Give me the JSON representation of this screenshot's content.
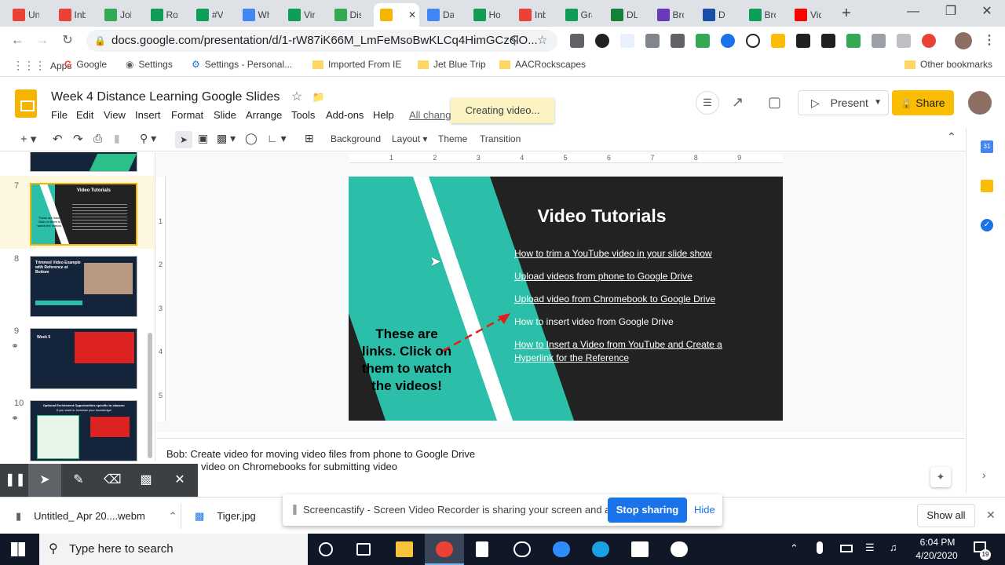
{
  "browser": {
    "tabs": [
      {
        "label": "Unt",
        "icon": "gmail-icon",
        "color": "#ea4335"
      },
      {
        "label": "Inb",
        "icon": "gmail-icon",
        "color": "#ea4335"
      },
      {
        "label": "Job",
        "icon": "drive-icon",
        "color": "#34a853"
      },
      {
        "label": "Rog",
        "icon": "sheets-icon",
        "color": "#0f9d58"
      },
      {
        "label": "#V",
        "icon": "sheets-icon",
        "color": "#0f9d58"
      },
      {
        "label": "Wh",
        "icon": "calendar-icon",
        "color": "#4285f4"
      },
      {
        "label": "Virt",
        "icon": "sheets-icon",
        "color": "#0f9d58"
      },
      {
        "label": "Dis",
        "icon": "drive-icon",
        "color": "#34a853"
      },
      {
        "label": "",
        "icon": "slides-icon",
        "color": "#f4b400",
        "active": true
      },
      {
        "label": "Dad",
        "icon": "docs-icon",
        "color": "#4285f4"
      },
      {
        "label": "Ho",
        "icon": "sheets-icon",
        "color": "#0f9d58"
      },
      {
        "label": "Inb",
        "icon": "gmail-icon",
        "color": "#ea4335"
      },
      {
        "label": "Gra",
        "icon": "sheets-icon",
        "color": "#0f9d58"
      },
      {
        "label": "DL",
        "icon": "classroom-icon",
        "color": "#188038"
      },
      {
        "label": "Bro",
        "icon": "forms-icon",
        "color": "#673ab7"
      },
      {
        "label": "D",
        "icon": "extension-icon",
        "color": "#174ea6"
      },
      {
        "label": "Bro",
        "icon": "sheets-icon",
        "color": "#0f9d58"
      },
      {
        "label": "Vid",
        "icon": "youtube-icon",
        "color": "#ff0000"
      }
    ],
    "url": "docs.google.com/presentation/d/1-rW87iK66M_LmFeMsoBwKLCq4HimGCz6lO...",
    "bookmarks": [
      {
        "label": "Apps",
        "icon": "apps-icon"
      },
      {
        "label": "Google",
        "icon": "google-icon"
      },
      {
        "label": "Settings",
        "icon": "globe-icon"
      },
      {
        "label": "Settings - Personal...",
        "icon": "gear-icon"
      },
      {
        "label": "Imported From IE",
        "icon": "folder-icon"
      },
      {
        "label": "Jet Blue Trip",
        "icon": "folder-icon"
      },
      {
        "label": "AACRockscapes",
        "icon": "folder-icon"
      }
    ],
    "other_bookmarks": "Other bookmarks"
  },
  "slides": {
    "doc_title": "Week 4 Distance Learning Google Slides",
    "menu": [
      "File",
      "Edit",
      "View",
      "Insert",
      "Format",
      "Slide",
      "Arrange",
      "Tools",
      "Add-ons",
      "Help",
      "All chang"
    ],
    "toast": "Creating video...",
    "present_label": "Present",
    "share_label": "Share",
    "toolbar": {
      "background": "Background",
      "layout": "Layout",
      "theme": "Theme",
      "transition": "Transition"
    },
    "ruler": [
      "1",
      "2",
      "3",
      "4",
      "5",
      "6",
      "7",
      "8",
      "9"
    ],
    "vruler": [
      "1",
      "2",
      "3",
      "4",
      "5"
    ],
    "filmstrip": [
      {
        "num": "7",
        "title": "Video Tutorials",
        "caption": "These are links. Click on them to watch the videos!",
        "selected": true
      },
      {
        "num": "8",
        "title": "Trimmed Video Example with Reference at Bottom",
        "selected": false
      },
      {
        "num": "9",
        "title": "Week 5",
        "selected": false
      },
      {
        "num": "10",
        "title": "Optional Enrichment Opportunities specific to classes:",
        "subtitle": "If you want to increase your knowledge!",
        "selected": false
      }
    ],
    "current_slide": {
      "title": "Video Tutorials",
      "left_text": "These are links. Click on them to watch the videos!",
      "links": [
        {
          "text": "How to trim a YouTube video in your slide show",
          "underlined": true
        },
        {
          "text": "Upload videos from phone to Google Drive",
          "underlined": true
        },
        {
          "text": "Upload video from Chromebook to Google Drive",
          "underlined": true
        },
        {
          "text": "How to insert video from Google Drive",
          "underlined": false
        },
        {
          "text": "How to Insert a Video from YouTube and Create a Hyperlink for the Reference",
          "underlined": true
        }
      ],
      "colors": {
        "teal": "#2bbfaa",
        "dark": "#222222",
        "arrow": "#e0201f"
      }
    },
    "notes": [
      "Bob: Create video for moving video files from phone to Google Drive",
      "video on Chromebooks for submitting video"
    ]
  },
  "screencastify": {
    "notice": "Screencastify - Screen Video Recorder is sharing your screen and audio.",
    "stop_label": "Stop sharing",
    "hide_label": "Hide"
  },
  "downloads": {
    "items": [
      "Untitled_ Apr 20....webm",
      "Tiger.jpg"
    ],
    "show_all": "Show all"
  },
  "taskbar": {
    "search_placeholder": "Type here to search",
    "time": "6:04 PM",
    "date": "4/20/2020",
    "notification_count": "19"
  }
}
